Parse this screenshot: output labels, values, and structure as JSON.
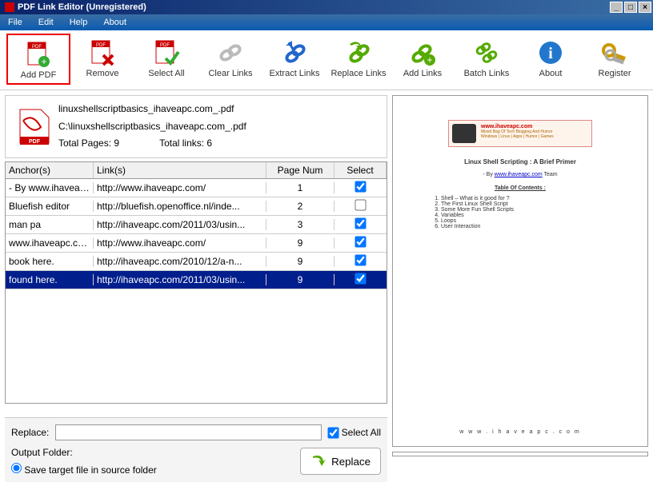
{
  "title": "PDF Link Editor (Unregistered)",
  "menu": [
    "File",
    "Edit",
    "Help",
    "About"
  ],
  "toolbar": [
    {
      "name": "add-pdf",
      "label": "Add PDF",
      "selected": true
    },
    {
      "name": "remove",
      "label": "Remove"
    },
    {
      "name": "select-all",
      "label": "Select All"
    },
    {
      "name": "clear-links",
      "label": "Clear Links"
    },
    {
      "name": "extract-links",
      "label": "Extract Links"
    },
    {
      "name": "replace-links",
      "label": "Replace Links"
    },
    {
      "name": "add-links",
      "label": "Add Links"
    },
    {
      "name": "batch-links",
      "label": "Batch Links"
    },
    {
      "name": "about",
      "label": "About"
    },
    {
      "name": "register",
      "label": "Register"
    }
  ],
  "file": {
    "name": "linuxshellscriptbasics_ihaveapc.com_.pdf",
    "path": "C:\\linuxshellscriptbasics_ihaveapc.com_.pdf",
    "pages_label": "Total Pages: 9",
    "links_label": "Total links: 6"
  },
  "grid": {
    "headers": {
      "anchor": "Anchor(s)",
      "link": "Link(s)",
      "page": "Page Num",
      "select": "Select"
    },
    "rows": [
      {
        "anchor": "- By www.ihaveapc...",
        "link": "http://www.ihaveapc.com/",
        "page": "1",
        "checked": true,
        "selected": false
      },
      {
        "anchor": "Bluefish   editor",
        "link": "http://bluefish.openoffice.nl/inde...",
        "page": "2",
        "checked": false,
        "selected": false
      },
      {
        "anchor": "man pa",
        "link": "http://ihaveapc.com/2011/03/usin...",
        "page": "3",
        "checked": true,
        "selected": false
      },
      {
        "anchor": "www.ihaveapc.com",
        "link": "http://www.ihaveapc.com/",
        "page": "9",
        "checked": true,
        "selected": false
      },
      {
        "anchor": "book here.",
        "link": "http://ihaveapc.com/2010/12/a-n...",
        "page": "9",
        "checked": true,
        "selected": false
      },
      {
        "anchor": "found here.",
        "link": "http://ihaveapc.com/2011/03/usin...",
        "page": "9",
        "checked": true,
        "selected": true
      }
    ]
  },
  "controls": {
    "replace_label": "Replace:",
    "replace_value": "",
    "selectall_label": "Select All",
    "selectall_checked": true,
    "output_label": "Output Folder:",
    "save_in_source_label": "Save target file in source folder",
    "save_in_source_checked": true,
    "replace_btn": "Replace"
  },
  "preview": {
    "banner_title": "www.ihaveapc.com",
    "banner_sub1": "Mixed Bag Of Tech Blogging And Humor",
    "banner_sub2": "Windows | Linux | Apps | Humor | Games",
    "doc_title": "Linux Shell Scripting : A Brief Primer",
    "by_prefix": "- By ",
    "by_link": "www.ihaveapc.com",
    "by_suffix": " Team",
    "toc_label": "Table Of Contents :",
    "items": [
      "Shell – What is it good for ?",
      "The First Linux Shell Script",
      "Some More Fun Shell Scripts",
      "Variables",
      "Loops",
      "User Interaction"
    ],
    "footer": "w w w . i h a v e a p c . c o m"
  }
}
